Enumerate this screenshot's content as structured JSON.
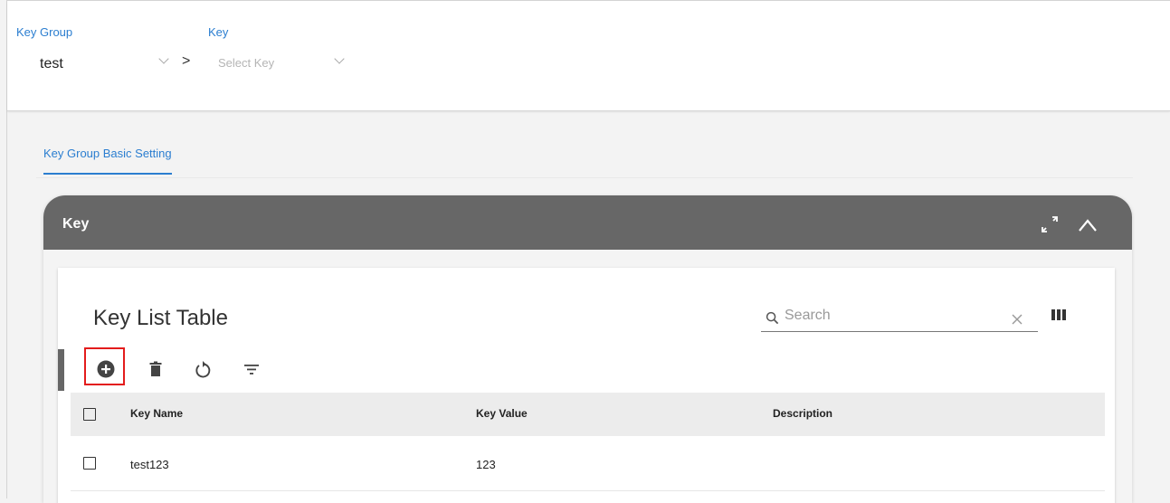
{
  "header": {
    "key_group_label": "Key Group",
    "key_group_value": "test",
    "key_label": "Key",
    "key_placeholder": "Select Key"
  },
  "tabs": [
    {
      "label": "Key Group Basic Setting",
      "active": true
    }
  ],
  "panel": {
    "title": "Key"
  },
  "table_card": {
    "title": "Key List Table",
    "search_placeholder": "Search",
    "toolbar_icons": [
      "add-circle-icon",
      "delete-icon",
      "undo-icon",
      "filter-icon"
    ],
    "columns": [
      "Key Name",
      "Key Value",
      "Description"
    ],
    "rows": [
      {
        "key_name": "test123",
        "key_value": "123",
        "description": ""
      }
    ]
  },
  "colors": {
    "accent": "#2b7ed0",
    "panel_header": "#676767",
    "highlight": "#e31c1c"
  }
}
